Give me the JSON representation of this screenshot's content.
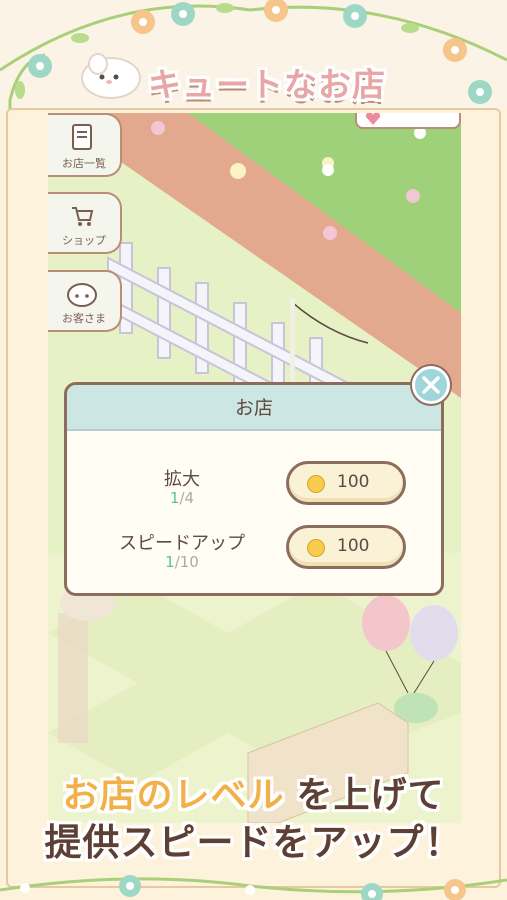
{
  "header": {
    "title": "キュートなお店"
  },
  "sidebar": {
    "items": [
      {
        "label": "お店一覧",
        "icon": "book-icon"
      },
      {
        "label": "ショップ",
        "icon": "cart-icon"
      },
      {
        "label": "お客さま",
        "icon": "customer-face-icon"
      }
    ]
  },
  "dialog": {
    "title": "お店",
    "rows": [
      {
        "name": "拡大",
        "level_current": "1",
        "level_max": "/4",
        "price": "100"
      },
      {
        "name": "スピードアップ",
        "level_current": "1",
        "level_max": "/10",
        "price": "100"
      }
    ],
    "close_icon": "close-icon"
  },
  "promo": {
    "line1_a": "お店のレベル",
    "line1_b": "を上げて",
    "line2": "提供スピードをアップ！"
  },
  "colors": {
    "title": "#e8a6a6",
    "accent_teal": "#9ed6da",
    "level_current": "#59c1a8",
    "promo_highlight": "#f2b04a",
    "promo_text": "#5d3f34"
  }
}
